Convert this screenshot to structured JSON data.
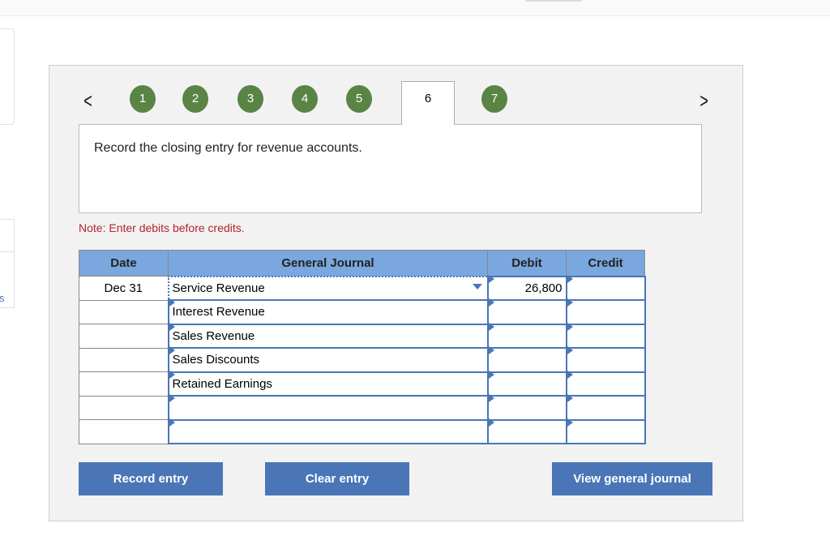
{
  "nav": {
    "prev": "<",
    "next": ">",
    "tabs": [
      "1",
      "2",
      "3",
      "4",
      "5",
      "6",
      "7"
    ],
    "active": "6"
  },
  "question": "Record the closing entry for revenue accounts.",
  "note": "Note: Enter debits before credits.",
  "table": {
    "headers": [
      "Date",
      "General Journal",
      "Debit",
      "Credit"
    ],
    "rows": [
      {
        "date": "Dec 31",
        "account": "Service Revenue",
        "debit": "26,800",
        "credit": ""
      },
      {
        "date": "",
        "account": "Interest Revenue",
        "debit": "",
        "credit": ""
      },
      {
        "date": "",
        "account": "Sales Revenue",
        "debit": "",
        "credit": ""
      },
      {
        "date": "",
        "account": "Sales Discounts",
        "debit": "",
        "credit": ""
      },
      {
        "date": "",
        "account": "Retained Earnings",
        "debit": "",
        "credit": ""
      },
      {
        "date": "",
        "account": "",
        "debit": "",
        "credit": ""
      },
      {
        "date": "",
        "account": "",
        "debit": "",
        "credit": ""
      }
    ]
  },
  "buttons": {
    "record": "Record entry",
    "clear": "Clear entry",
    "view": "View general journal"
  },
  "side": {
    "link": "s"
  },
  "colors": {
    "accent": "#4a76b8",
    "tab_done": "#5a8445",
    "header": "#7aa7de",
    "note": "#b3242a"
  }
}
